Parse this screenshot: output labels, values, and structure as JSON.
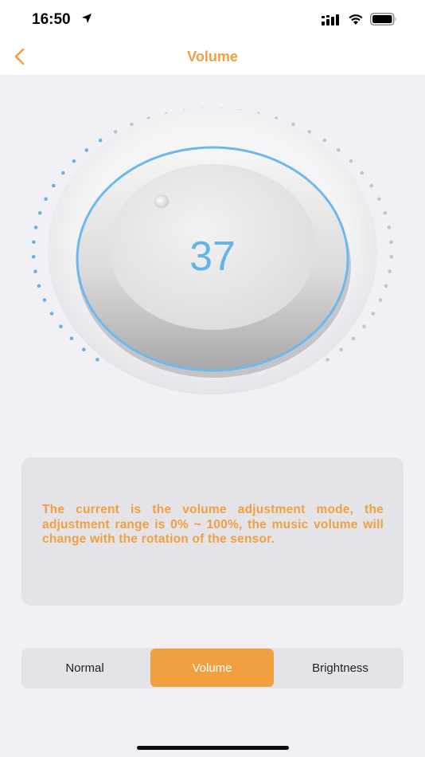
{
  "status_bar": {
    "time": "16:50"
  },
  "nav": {
    "title": "Volume",
    "back_icon": "chevron-left-icon"
  },
  "dial": {
    "value": "37",
    "level_percent": 37,
    "active_color": "#62b4ea",
    "inactive_color": "#c4c4c8"
  },
  "info": {
    "text": "The current is the volume adjustment mode, the adjustment range is 0% ~ 100%, the music volume will change with the rotation of the sensor."
  },
  "modes": {
    "items": [
      {
        "label": "Normal",
        "active": false
      },
      {
        "label": "Volume",
        "active": true
      },
      {
        "label": "Brightness",
        "active": false
      }
    ]
  },
  "colors": {
    "accent": "#f0a040",
    "dial_ring": "#6db8ec",
    "background": "#f1f1f5",
    "card": "#e4e4e8"
  }
}
